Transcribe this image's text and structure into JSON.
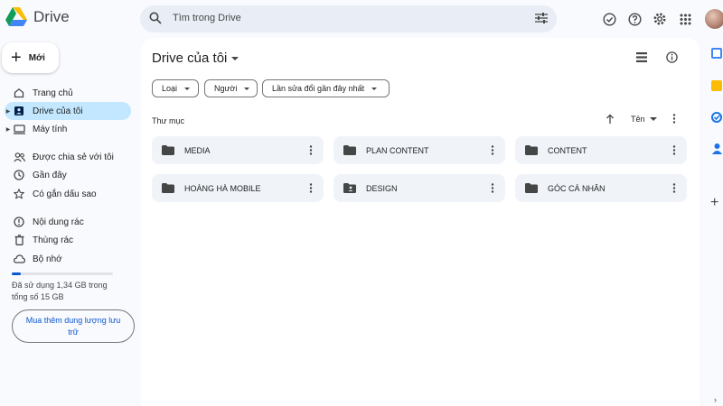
{
  "header": {
    "app_name": "Drive",
    "search": {
      "placeholder": "Tìm trong Drive"
    },
    "icons": [
      "offline-ready-icon",
      "help-icon",
      "settings-icon",
      "apps-grid-icon"
    ]
  },
  "sidebar": {
    "new_label": "Mới",
    "items": [
      {
        "label": "Trang chủ",
        "icon": "home-icon"
      },
      {
        "label": "Drive của tôi",
        "icon": "my-drive-icon",
        "active": true
      },
      {
        "label": "Máy tính",
        "icon": "computer-icon"
      },
      {
        "label": "Được chia sẻ với tôi",
        "icon": "shared-icon"
      },
      {
        "label": "Gần đây",
        "icon": "clock-icon"
      },
      {
        "label": "Có gắn dấu sao",
        "icon": "star-icon"
      },
      {
        "label": "Nội dung rác",
        "icon": "spam-icon"
      },
      {
        "label": "Thùng rác",
        "icon": "trash-icon"
      },
      {
        "label": "Bộ nhớ",
        "icon": "cloud-icon"
      }
    ],
    "storage": {
      "used_fraction": 0.09,
      "text": "Đã sử dụng 1,34 GB trong tổng số 15 GB",
      "buy_label": "Mua thêm dung lượng lưu trữ"
    }
  },
  "main": {
    "title": "Drive của tôi",
    "filters": [
      "Loại",
      "Người",
      "Lần sửa đổi gần đây nhất"
    ],
    "section_label": "Thư mục",
    "sort_label": "Tên",
    "folders": [
      {
        "name": "MEDIA",
        "shared": false
      },
      {
        "name": "PLAN CONTENT",
        "shared": false
      },
      {
        "name": "CONTENT",
        "shared": false
      },
      {
        "name": "HOÀNG HÀ MOBILE",
        "shared": false
      },
      {
        "name": "DESIGN",
        "shared": true
      },
      {
        "name": "GÓC CÁ NHÂN",
        "shared": false
      }
    ]
  },
  "colors": {
    "accent": "#0b57d0",
    "active_nav": "#c2e7ff",
    "background": "#f8fafd",
    "folder_card": "#f0f4f9"
  }
}
